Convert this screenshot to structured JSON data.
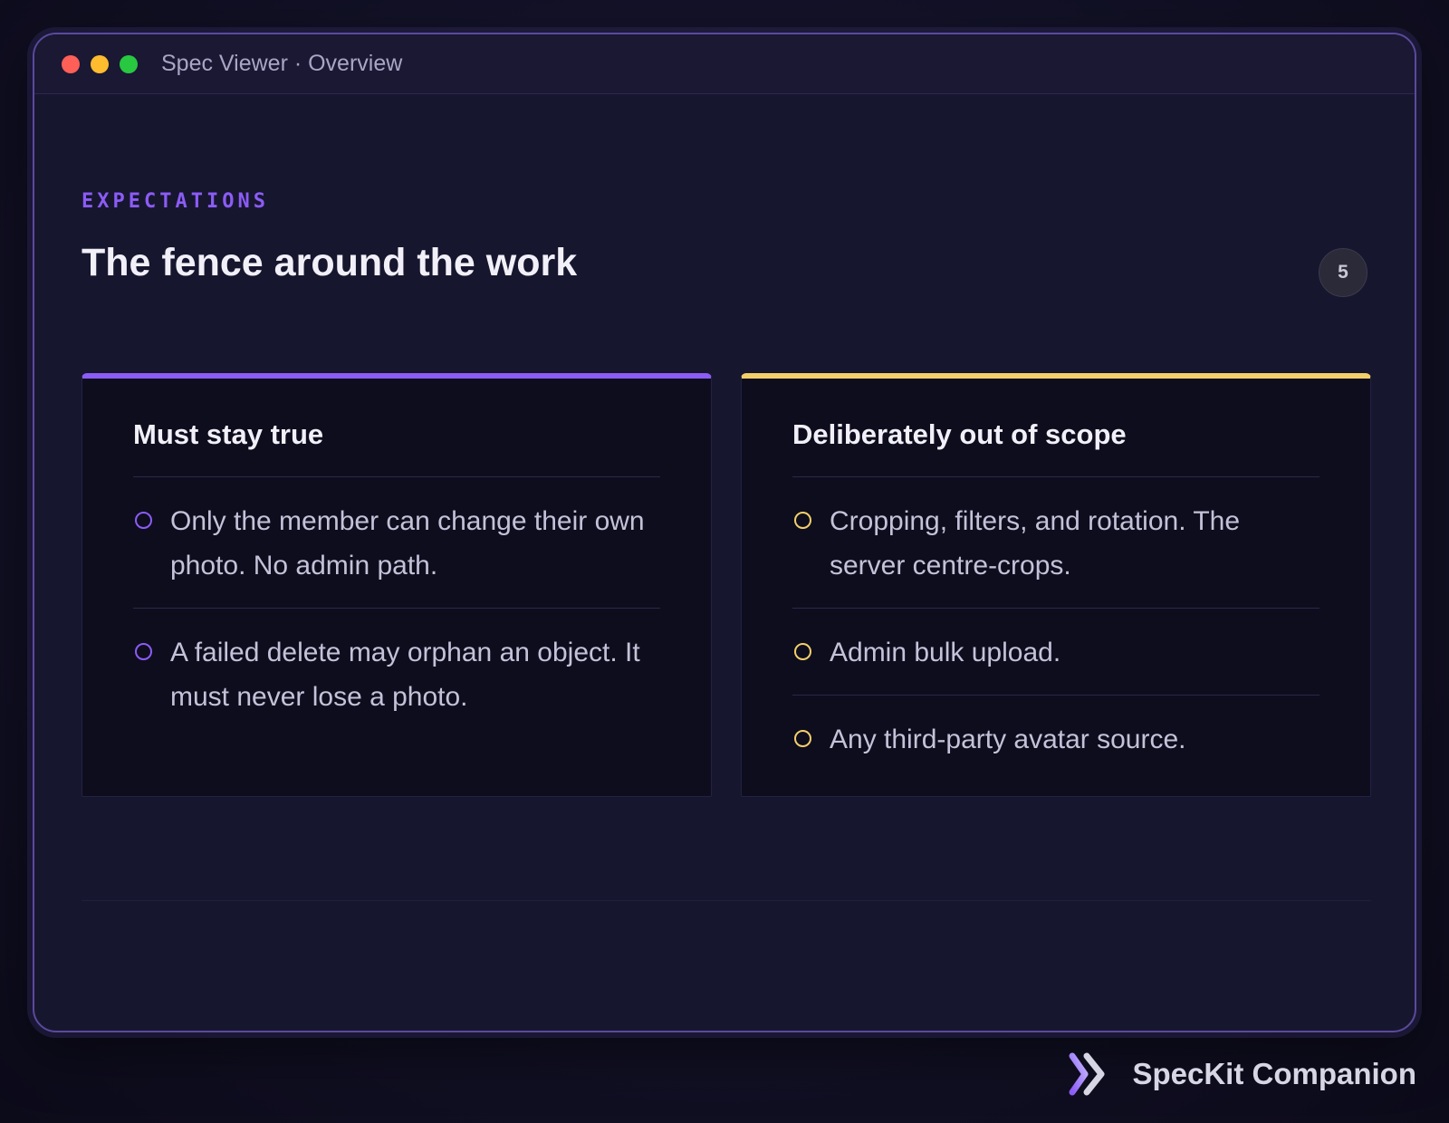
{
  "window": {
    "title": "Spec Viewer · Overview"
  },
  "header": {
    "eyebrow": "EXPECTATIONS",
    "title": "The fence around the work",
    "page_number": "5"
  },
  "cards": [
    {
      "title": "Must stay true",
      "accent": "#8b5cf6",
      "items": [
        "Only the member can change their own photo. No admin path.",
        "A failed delete may orphan an object. It must never lose a photo."
      ]
    },
    {
      "title": "Deliberately out of scope",
      "accent": "#f3cf6a",
      "items": [
        "Cropping, filters, and rotation. The server centre-crops.",
        "Admin bulk upload.",
        "Any third-party avatar source."
      ]
    }
  ],
  "brand": {
    "name": "SpecKit Companion",
    "icon": "speckit-chevron-icon"
  },
  "colors": {
    "accent_purple": "#8b5cf6",
    "accent_yellow": "#f3cf6a",
    "traffic_red": "#fe5f57",
    "traffic_yellow": "#febc2e",
    "traffic_green": "#28c840"
  }
}
